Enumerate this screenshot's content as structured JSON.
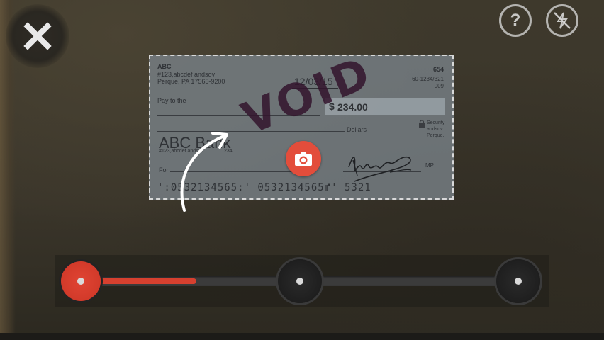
{
  "top_controls": {
    "close_icon": "close-icon",
    "help_icon": "help-icon",
    "help_glyph": "?",
    "flash_icon": "flash-off-icon"
  },
  "check": {
    "payer_name": "ABC",
    "payer_address_line1": "#123,abcdef andsov",
    "payer_address_line2": "Perque, PA 17565-9200",
    "check_number": "654",
    "routing_fraction": "60-1234/321",
    "routing_extra": "009",
    "date": "12/03/15",
    "pay_to_label": "Pay to the",
    "dollar_sign": "$",
    "amount": "234.00",
    "dollars_label": "Dollars",
    "security_text": "Security andsov Perque,",
    "bank_name": "ABC Bank",
    "bank_address": "#123,abcdef andsov",
    "bank_address_2": "Perque, PA 17565",
    "bank_number": "234",
    "for_label": "For",
    "mp_label": "MP",
    "micr_line": "':0532134565:' 0532134565⑈' 5321",
    "void_stamp": "VOID"
  },
  "capture": {
    "camera_icon": "camera-icon",
    "hint_icon": "curved-arrow-icon"
  },
  "slider": {
    "stops": 3,
    "selected_index": 0,
    "progress_fraction": 0.26,
    "accent_color": "#d6402f"
  },
  "colors": {
    "accent": "#e34d3b",
    "frame_overlay": "#787f86"
  }
}
